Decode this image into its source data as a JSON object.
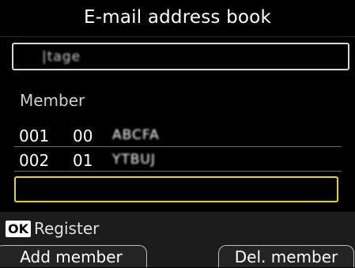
{
  "title": "E-mail address book",
  "name_field": {
    "value": "|tage"
  },
  "member_section": {
    "label": "Member",
    "rows": [
      {
        "number": "001",
        "group": "00",
        "name": "ABCFA"
      },
      {
        "number": "002",
        "group": "01",
        "name": "YTBUJ"
      }
    ]
  },
  "footer": {
    "ok_label": "OK",
    "ok_action": "Register",
    "left_softkey": "Add member",
    "right_softkey": "Del. member"
  },
  "colors": {
    "background": "#000000",
    "highlight": "#e4d42a",
    "footer": "#1c1c1c"
  }
}
